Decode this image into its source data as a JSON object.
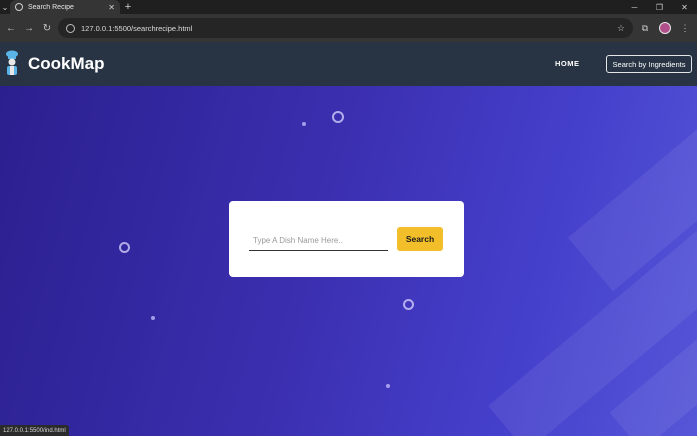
{
  "browser": {
    "tab_title": "Search Recipe",
    "url": "127.0.0.1:5500/searchrecipe.html",
    "status_url": "127.0.0.1:5500/ind.html"
  },
  "site": {
    "brand": "CookMap",
    "nav": {
      "home": "HOME",
      "search_by_ingredients": "Search by Ingredients"
    }
  },
  "search": {
    "placeholder": "Type A Dish Name Here..",
    "button_label": "Search"
  },
  "colors": {
    "header_bg": "#283443",
    "hero_start": "#2b1f8f",
    "hero_end": "#5656d8",
    "button": "#f2bf2a"
  }
}
